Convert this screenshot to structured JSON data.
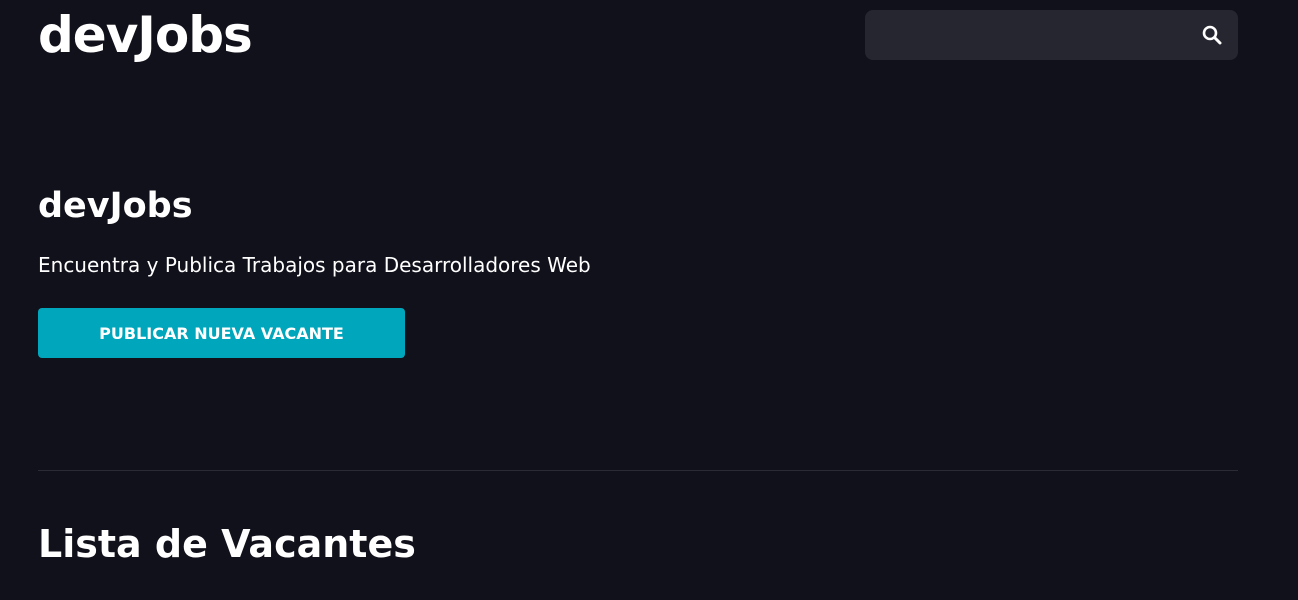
{
  "header": {
    "logo_text": "devJobs",
    "search": {
      "value": "",
      "placeholder": "",
      "icon": "search-icon"
    }
  },
  "hero": {
    "title": "devJobs",
    "subtitle": "Encuentra y Publica Trabajos para Desarrolladores Web",
    "cta_label": "PUBLICAR NUEVA VACANTE"
  },
  "listing": {
    "title": "Lista de Vacantes"
  },
  "colors": {
    "background": "#11111b",
    "search_background": "#262631",
    "accent": "#00a6bb",
    "text": "#ffffff",
    "divider": "#2b2b36"
  }
}
